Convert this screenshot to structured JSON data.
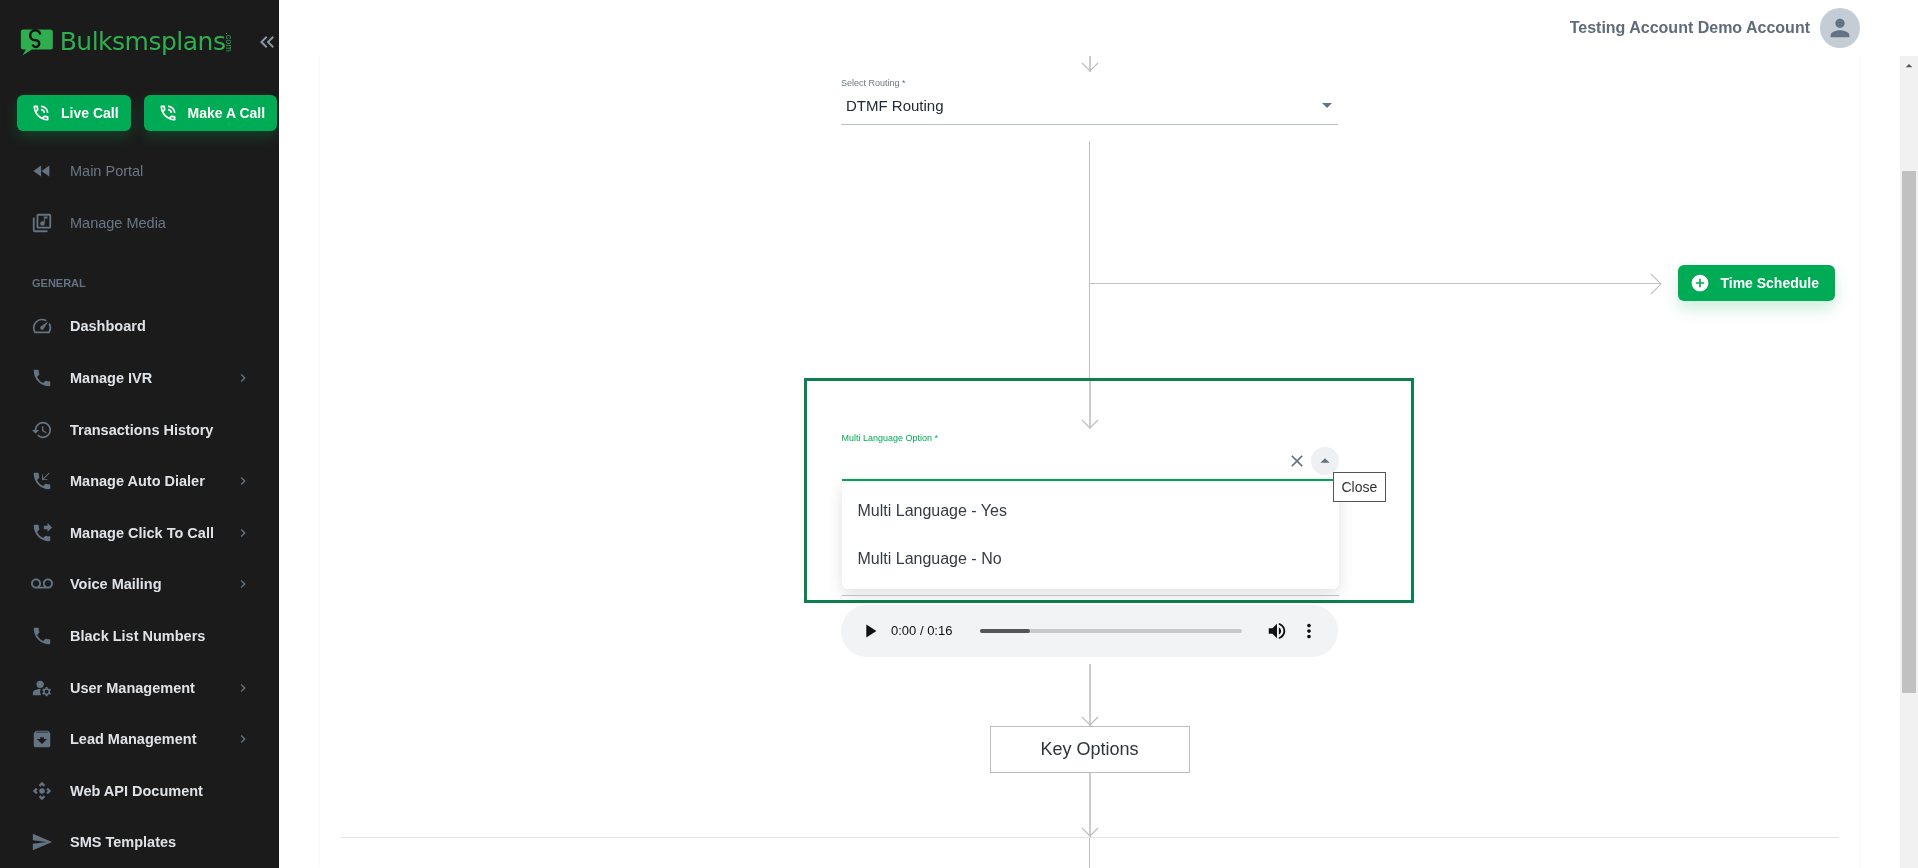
{
  "sidebar": {
    "logo": {
      "name": "Bulksmsplans",
      "suffix": ".com"
    },
    "actions": [
      {
        "label": "Live Call"
      },
      {
        "label": "Make A Call"
      }
    ],
    "portal_links": [
      {
        "label": "Main Portal"
      },
      {
        "label": "Manage Media"
      }
    ],
    "section_title": "GENERAL",
    "items": [
      {
        "label": "Dashboard",
        "expandable": false
      },
      {
        "label": "Manage IVR",
        "expandable": true
      },
      {
        "label": "Transactions History",
        "expandable": false
      },
      {
        "label": "Manage Auto Dialer",
        "expandable": true
      },
      {
        "label": "Manage Click To Call",
        "expandable": true
      },
      {
        "label": "Voice Mailing",
        "expandable": true
      },
      {
        "label": "Black List Numbers",
        "expandable": false
      },
      {
        "label": "User Management",
        "expandable": true
      },
      {
        "label": "Lead Management",
        "expandable": true
      },
      {
        "label": "Web API Document",
        "expandable": false
      },
      {
        "label": "SMS Templates",
        "expandable": false
      }
    ]
  },
  "header": {
    "user_name": "Testing Account Demo Account"
  },
  "flow": {
    "routing": {
      "label": "Select Routing *",
      "value": "DTMF Routing"
    },
    "branch_button": "Time Schedule",
    "multi_language": {
      "label": "Multi Language Option *",
      "open": true,
      "tooltip": "Close",
      "options": [
        {
          "label": "Multi Language - Yes"
        },
        {
          "label": "Multi Language - No"
        }
      ]
    },
    "audio": {
      "time": "0:00 / 0:16",
      "level": 0.19
    },
    "key_options": "Key Options"
  }
}
